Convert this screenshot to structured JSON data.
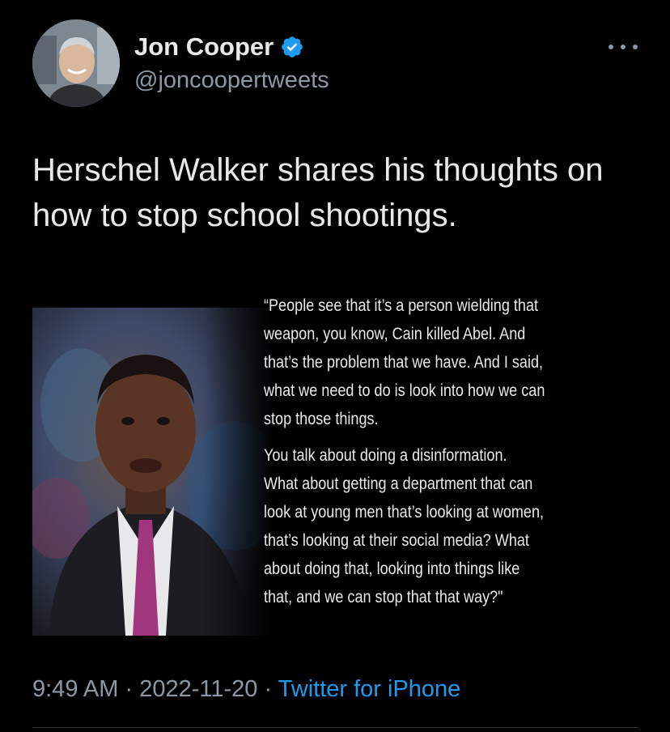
{
  "author": {
    "display_name": "Jon Cooper",
    "handle": "@joncoopertweets",
    "verified": true
  },
  "tweet": {
    "text": "Herschel Walker shares his thoughts on how to stop school shootings."
  },
  "media": {
    "quote_paragraph_1": "“People see that it’s a person wielding that\nweapon, you know, Cain killed Abel. And\nthat’s the problem that we have. And I said,\nwhat we need to do is look into how we can\nstop those things.",
    "quote_paragraph_2": "You talk about doing a disinformation.\nWhat about getting a department that can\nlook at young men that’s looking at women,\nthat’s looking at their social media? What\nabout doing that, looking into things like\nthat, and we can stop that that way?\""
  },
  "meta": {
    "time": "9:49 AM",
    "separator": " · ",
    "date": "2022-11-20",
    "source": "Twitter for iPhone"
  },
  "colors": {
    "background": "#000000",
    "text_primary": "#e7e9ea",
    "text_secondary": "#8b98a5",
    "accent": "#1d9bf0"
  },
  "icons": {
    "verified": "verified-badge-icon",
    "more": "more-options-icon"
  }
}
